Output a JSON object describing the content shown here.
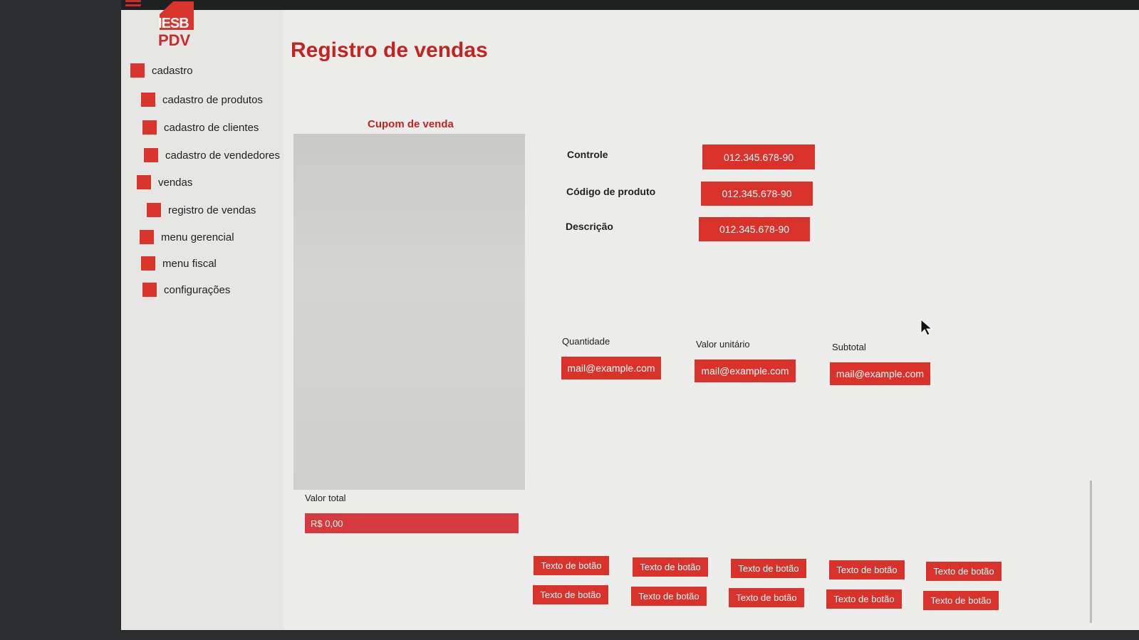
{
  "app": {
    "logo_text": "IESB",
    "product": "PDV"
  },
  "sidebar": {
    "items": [
      {
        "label": "cadastro"
      },
      {
        "label": "cadastro de produtos"
      },
      {
        "label": "cadastro de clientes"
      },
      {
        "label": "cadastro de vendedores"
      },
      {
        "label": "vendas"
      },
      {
        "label": "registro de vendas"
      },
      {
        "label": "menu gerencial"
      },
      {
        "label": "menu fiscal"
      },
      {
        "label": "configurações"
      }
    ]
  },
  "main": {
    "title": "Registro de vendas",
    "cupom_title": "Cupom de venda",
    "valor_total_label": "Valor total",
    "valor_total_value": "R$ 0,00",
    "fields": {
      "controle_label": "Controle",
      "controle_value": "012.345.678-90",
      "codigo_label": "Código de produto",
      "codigo_value": "012.345.678-90",
      "descricao_label": "Descrição",
      "descricao_value": "012.345.678-90",
      "quantidade_label": "Quantidade",
      "quantidade_value": "mail@example.com",
      "valor_unitario_label": "Valor unitário",
      "valor_unitario_value": "mail@example.com",
      "subtotal_label": "Subtotal",
      "subtotal_value": "mail@example.com"
    },
    "buttons": [
      "Texto de botão",
      "Texto de botão",
      "Texto de botão",
      "Texto de botão",
      "Texto de botão",
      "Texto de botão",
      "Texto de botão",
      "Texto de botão",
      "Texto de botão",
      "Texto de botão"
    ]
  },
  "colors": {
    "accent": "#d8322b",
    "title": "#c0261f"
  }
}
